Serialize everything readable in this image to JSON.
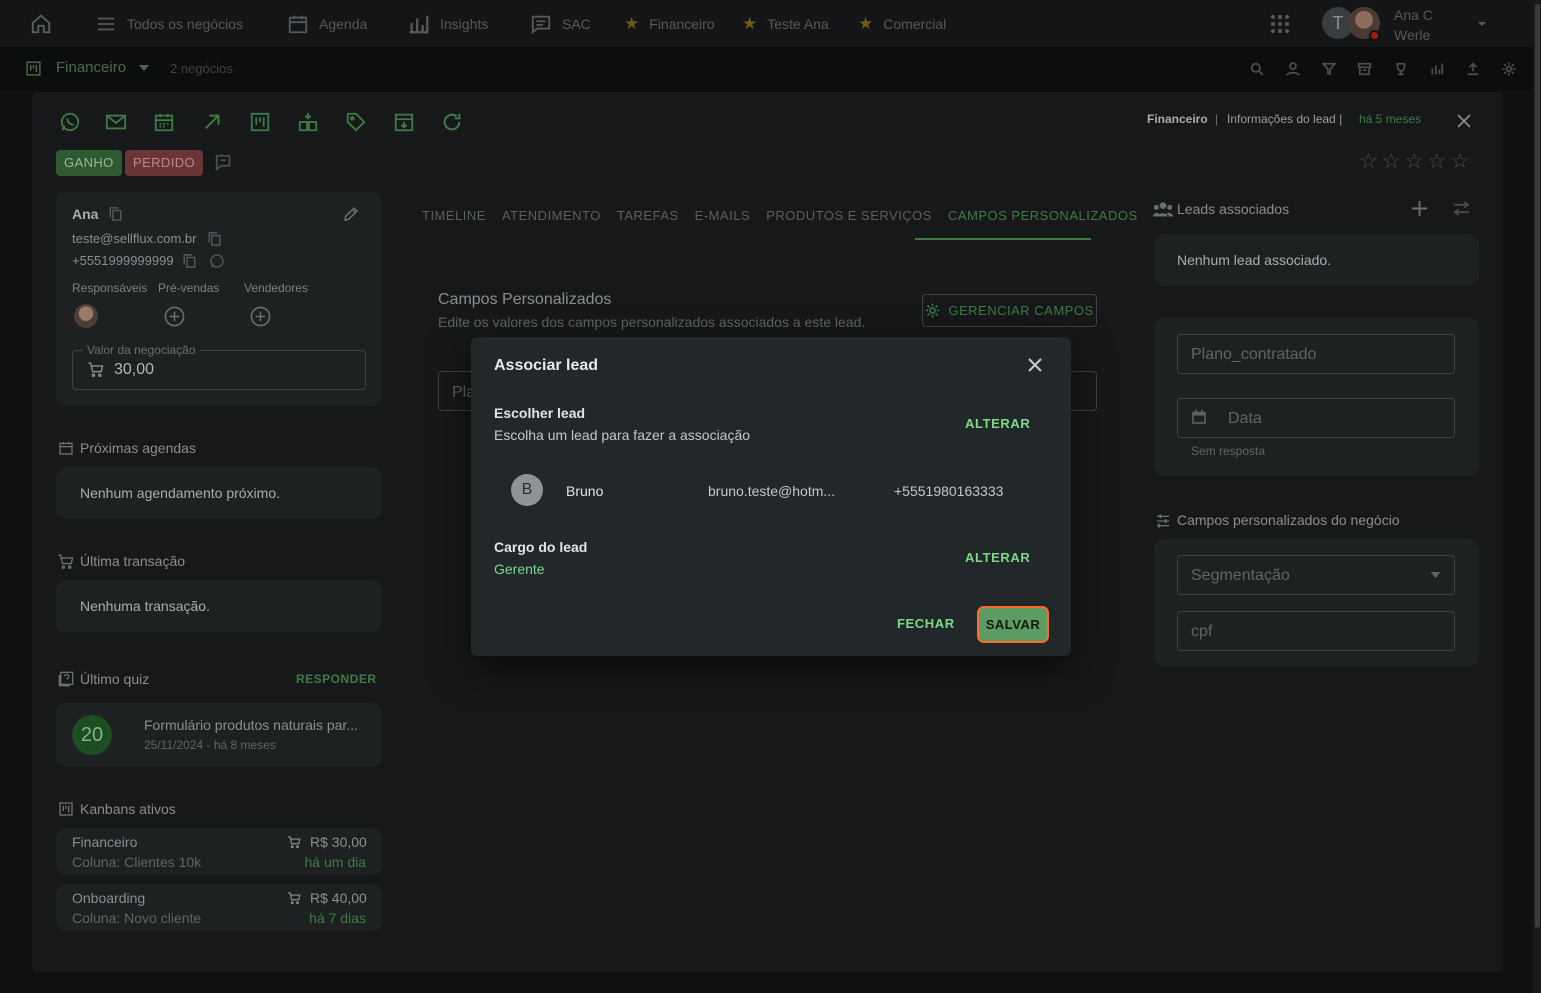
{
  "topnav": {
    "items": [
      "Todos os negócios",
      "Agenda",
      "Insights",
      "SAC"
    ],
    "favorites": [
      "Financeiro",
      "Teste Ana",
      "Comercial"
    ],
    "avatar_initial": "T",
    "user_first": "Ana C",
    "user_last": "Werle"
  },
  "board": {
    "name": "Financeiro",
    "count": "2 negócios"
  },
  "header": {
    "pipeline": "Financeiro",
    "separator": "|",
    "info": "Informações do lead |",
    "time": "há 5 meses"
  },
  "status": {
    "won": "GANHO",
    "lost": "PERDIDO"
  },
  "rating": {
    "value": 0,
    "max": 5
  },
  "lead": {
    "name": "Ana",
    "email": "teste@sellflux.com.br",
    "phone": "+5551999999999",
    "responsaveis_label": "Responsáveis",
    "prevendas_label": "Pré-vendas",
    "vendedores_label": "Vendedores",
    "value_label": "Valor da negociação",
    "value": "30,00"
  },
  "agenda": {
    "title": "Próximas agendas",
    "empty": "Nenhum agendamento próximo."
  },
  "transaction": {
    "title": "Última transação",
    "empty": "Nenhuma transação."
  },
  "quiz": {
    "title": "Último quiz",
    "action": "RESPONDER",
    "score": "20",
    "name": "Formulário produtos naturais par...",
    "date": "25/11/2024 - há 8 meses"
  },
  "kanbans": {
    "title": "Kanbans ativos",
    "items": [
      {
        "name": "Financeiro",
        "column": "Coluna: Clientes 10k",
        "value": "R$ 30,00",
        "time": "há um dia"
      },
      {
        "name": "Onboarding",
        "column": "Coluna: Novo cliente",
        "value": "R$ 40,00",
        "time": "há 7 dias"
      }
    ]
  },
  "tabs": [
    "TIMELINE",
    "ATENDIMENTO",
    "TAREFAS",
    "E-MAILS",
    "PRODUTOS E SERVIÇOS",
    "CAMPOS PERSONALIZADOS"
  ],
  "custom_fields": {
    "title": "Campos Personalizados",
    "subtitle": "Edite os valores dos campos personalizados associados a este lead.",
    "manage": "GERENCIAR CAMPOS",
    "field_partial": "Pla"
  },
  "associated": {
    "title": "Leads associados",
    "empty": "Nenhum lead associado."
  },
  "lead_fields": {
    "plano": "Plano_contratado",
    "data": "Data",
    "data_hint": "Sem resposta"
  },
  "deal_fields": {
    "title": "Campos personalizados do negócio",
    "segmentacao": "Segmentação",
    "cpf": "cpf"
  },
  "dialog": {
    "title": "Associar lead",
    "choose_title": "Escolher lead",
    "choose_sub": "Escolha um lead para fazer a associação",
    "change": "ALTERAR",
    "lead_initial": "B",
    "lead_name": "Bruno",
    "lead_email": "bruno.teste@hotm...",
    "lead_phone": "+5551980163333",
    "role_title": "Cargo do lead",
    "role_value": "Gerente",
    "close": "FECHAR",
    "save": "SALVAR"
  },
  "colors": {
    "accent": "#3f7a45",
    "accent_bright": "#7ed88a",
    "focus": "#ff6a2b",
    "lost": "#6a3537"
  }
}
